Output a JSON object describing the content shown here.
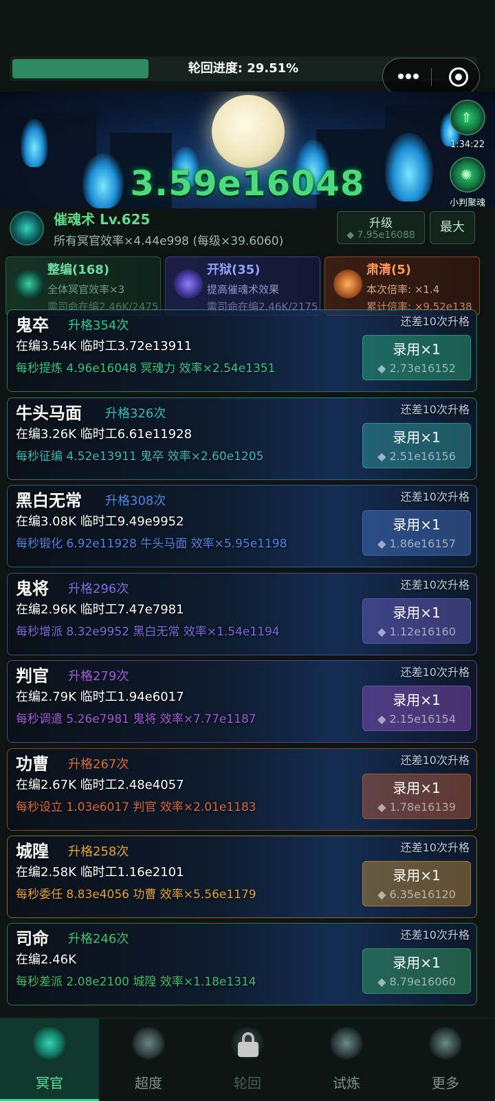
{
  "progress": {
    "label": "轮回进度: 29.51%",
    "percent": 29.51
  },
  "banner": {
    "total": "3.59e16048",
    "timer": "1:34:22",
    "side_label": "小判聚魂"
  },
  "skill": {
    "name": "催魂术 Lv.625",
    "desc": "所有冥官效率×4.44e998 (每级×39.6060)",
    "upgrade_label": "升级",
    "upgrade_cost": "◆ 7.95e16088",
    "max_label": "最大"
  },
  "panels": [
    {
      "title": "整编(168)",
      "desc": "全体冥官效率×3",
      "req": "需司命在编2.46K/2475"
    },
    {
      "title": "开狱(35)",
      "desc": "提高催魂术效果",
      "req": "需司命在编2.46K/2175"
    },
    {
      "title": "肃清(5)",
      "desc": "本次倍率: ×1.4",
      "req": "累计倍率: ×9.52e138"
    }
  ],
  "cards": [
    {
      "name": "鬼卒",
      "level": "升格354次",
      "line2": "在编3.54K  临时工3.72e13911",
      "line3": "每秒提炼 4.96e16048 冥魂力  效率×2.54e1351",
      "remain": "还差10次升格",
      "hire": "录用×1",
      "cost": "◆ 2.73e16152",
      "color": "#33c78a"
    },
    {
      "name": "牛头马面",
      "level": "升格326次",
      "line2": "在编3.26K  临时工6.61e11928",
      "line3": "每秒征编 4.52e13911 鬼卒  效率×2.60e1205",
      "remain": "还差10次升格",
      "hire": "录用×1",
      "cost": "◆ 2.51e16156",
      "color": "#3ab9b8"
    },
    {
      "name": "黑白无常",
      "level": "升格308次",
      "line2": "在编3.08K  临时工9.49e9952",
      "line3": "每秒锻化 6.92e11928 牛头马面  效率×5.95e1198",
      "remain": "还差10次升格",
      "hire": "录用×1",
      "cost": "◆ 1.86e16157",
      "color": "#4f84e0"
    },
    {
      "name": "鬼将",
      "level": "升格296次",
      "line2": "在编2.96K  临时工7.47e7981",
      "line3": "每秒增派 8.32e9952 黑白无常  效率×1.54e1194",
      "remain": "还差10次升格",
      "hire": "录用×1",
      "cost": "◆ 1.12e16160",
      "color": "#7b6bdc"
    },
    {
      "name": "判官",
      "level": "升格279次",
      "line2": "在编2.79K  临时工1.94e6017",
      "line3": "每秒调遣 5.26e7981 鬼将  效率×7.77e1187",
      "remain": "还差10次升格",
      "hire": "录用×1",
      "cost": "◆ 2.15e16154",
      "color": "#a15ad6"
    },
    {
      "name": "功曹",
      "level": "升格267次",
      "line2": "在编2.67K  临时工2.48e4057",
      "line3": "每秒设立 1.03e6017 判官  效率×2.01e1183",
      "remain": "还差10次升格",
      "hire": "录用×1",
      "cost": "◆ 1.78e16139",
      "color": "#d96a3e"
    },
    {
      "name": "城隍",
      "level": "升格258次",
      "line2": "在编2.58K  临时工1.16e2101",
      "line3": "每秒委任 8.83e4056 功曹  效率×5.56e1179",
      "remain": "还差10次升格",
      "hire": "录用×1",
      "cost": "◆ 6.35e16120",
      "color": "#e0a23a"
    },
    {
      "name": "司命",
      "level": "升格246次",
      "line2": "在编2.46K",
      "line3": "每秒差派 2.08e2100 城隍  效率×1.18e1314",
      "remain": "还差10次升格",
      "hire": "录用×1",
      "cost": "◆ 8.79e16060",
      "color": "#3fbf6e"
    }
  ],
  "nav": [
    {
      "label": "冥官",
      "active": true
    },
    {
      "label": "超度",
      "active": false
    },
    {
      "label": "轮回",
      "active": false
    },
    {
      "label": "试炼",
      "active": false
    },
    {
      "label": "更多",
      "active": false
    }
  ]
}
